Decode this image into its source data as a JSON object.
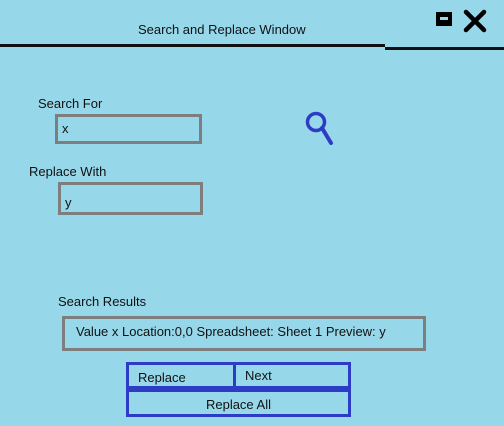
{
  "window": {
    "title": "Search and Replace Window",
    "minimize_icon": "minimize-icon",
    "close_icon": "close-icon"
  },
  "search": {
    "label": "Search For",
    "value": "x",
    "icon": "search-icon"
  },
  "replace": {
    "label": "Replace With",
    "value": "y"
  },
  "results": {
    "label": "Search Results",
    "row": "Value x Location:0,0 Spreadsheet: Sheet 1 Preview: y"
  },
  "buttons": {
    "replace_label": "Replace",
    "next_label": "Next",
    "replace_all_label": "Replace All"
  },
  "colors": {
    "background": "#97d7ea",
    "field_border": "#7e7e7e",
    "button_border": "#2d3cc4",
    "icon": "#2d3cc4"
  }
}
